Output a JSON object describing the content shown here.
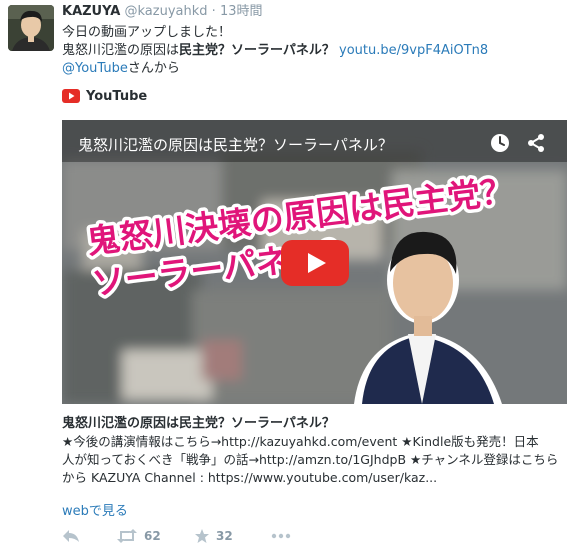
{
  "tweet": {
    "name": "KAZUYA",
    "handle": "@kazuyahkd",
    "separator": "·",
    "time": "13時間",
    "line1": "今日の動画アップしました！",
    "line2_plain": "鬼怒川氾濫の原因は",
    "line2_bold": "民主党？ソーラーパネル？",
    "line2_link": "youtu.be/9vpF4AiOTn8",
    "line3_link": "@YouTube",
    "line3_plain": "さんから"
  },
  "card": {
    "source": "YouTube",
    "video_title": "鬼怒川氾濫の原因は民主党？ソーラーパネル？",
    "thumbnail_caption_1": "鬼怒川決壊の原因は民主党？",
    "thumbnail_caption_2": "ソーラーパネル？",
    "title": "鬼怒川氾濫の原因は民主党？ソーラーパネル？",
    "desc_line1": "★今後の講演情報はこちら→http://kazuyahkd.com/event ★Kindle版も発売！日本",
    "desc_line2": "人が知っておくべき「戦争」の話→http://amzn.to/1GJhdpB ★チャンネル登録はこちら",
    "desc_line3": "から KAZUYA Channel : https://www.youtube.com/user/kaz..."
  },
  "web_link": "webで見る",
  "actions": {
    "retweet_count": "62",
    "favorite_count": "32"
  },
  "colors": {
    "link": "#2b7bb9",
    "meta_gray": "#8899a6",
    "text": "#292f33",
    "youtube_red": "#e52d27",
    "caption_magenta": "#e0157a"
  }
}
